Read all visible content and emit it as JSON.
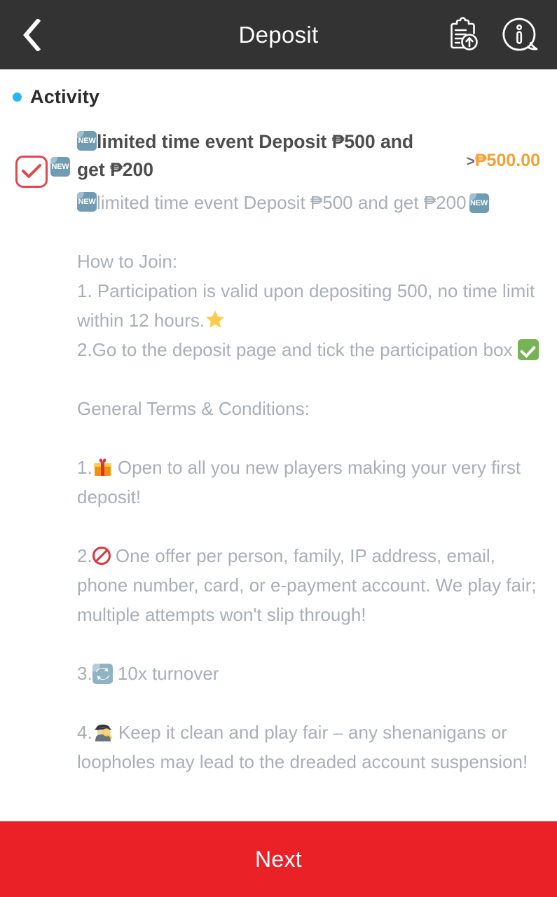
{
  "header": {
    "title": "Deposit",
    "back_icon": "chevron-left-icon",
    "records_icon": "clipboard-upload-icon",
    "info_icon": "info-bubble-icon"
  },
  "activity": {
    "label": "Activity",
    "bullet_color": "#26b6f0"
  },
  "promo": {
    "checkbox_checked": true,
    "checkbox_color": "#e0474c",
    "badge_label": "NEW",
    "title": "limited time event Deposit ₱500 and get ₱200",
    "chevron": ">",
    "amount": "₱500.00",
    "amount_color": "#f5a033"
  },
  "details": {
    "headline": "limited time event Deposit ₱500 and get ₱200",
    "join_heading": "How to Join:",
    "join_1": "1. Participation is valid upon depositing 500, no time limit within 12 hours.",
    "join_2": "2.Go to the deposit page and tick the participation box",
    "terms_heading": "General Terms & Conditions:",
    "term_1_num": "1.",
    "term_1": "Open to all you new players making your very first deposit!",
    "term_2_num": "2.",
    "term_2": "One offer per person, family, IP address, email, phone number, card, or e-payment account. We play fair; multiple attempts won't slip through!",
    "term_3_num": "3.",
    "term_3": "10x turnover",
    "term_4_num": "4.",
    "term_4": "Keep it clean and play fair – any shenanigans or loopholes may lead to the dreaded account suspension!"
  },
  "footer": {
    "next_label": "Next",
    "next_color": "#ea2227"
  }
}
